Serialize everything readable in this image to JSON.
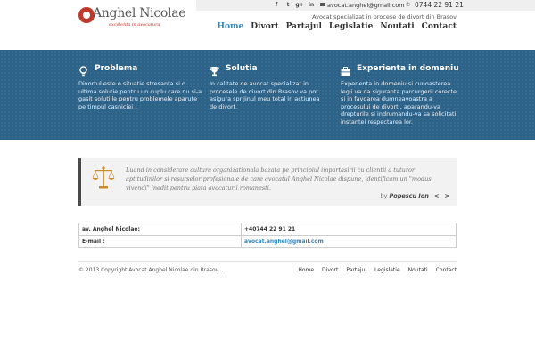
{
  "brand": {
    "name": "Anghel Nicolae",
    "tagline": "excelenta in avocatura"
  },
  "topbar": {
    "social": [
      {
        "icon": "facebook-icon",
        "glyph": "f"
      },
      {
        "icon": "twitter-icon",
        "glyph": "t"
      },
      {
        "icon": "google-plus-icon",
        "glyph": "g+"
      },
      {
        "icon": "linkedin-icon",
        "glyph": "in"
      }
    ],
    "email": "avocat.anghel@gmail.com",
    "phone": "0744 22 91 21"
  },
  "header": {
    "tagline": "Avocat specializat in procese de divort din Brasov"
  },
  "nav": {
    "items": [
      "Home",
      "Divort",
      "Partajul",
      "Legislatie",
      "Noutati",
      "Contact"
    ],
    "active": "Home"
  },
  "features": [
    {
      "icon": "lightbulb-icon",
      "title": "Problema",
      "text": "Divortul este o situatie stresanta si o ultima solutie pentru un cuplu care nu si-a gasit solutiile pentru problemele aparute pe timpul casniciei ."
    },
    {
      "icon": "trophy-icon",
      "title": "Solutia",
      "text": "In calitate de avocat specializat in procesele de divort din Brasov va pot asigura sprijinul meu total in actiunea de divort."
    },
    {
      "icon": "briefcase-icon",
      "title": "Experienta in domeniu",
      "text": "Experienta in domeniu si cunoasterea legii va da siguranta parcurgerii corecte si in favoarea dumneavoastra a procesului de divort , aparandu-va drepturile si indrumandu-va sa solicitati instantei respectarea lor."
    }
  ],
  "quote": {
    "text": "Luand in considerare cultura organizationala bazata pe principiul impartasirii cu clientii a tuturor aptitudinilor si resurselor profesionale de care avocatul Anghel Nicolae dispune, identificam un \"modus vivendi\" inedit pentru piata avocaturii romanesti.",
    "by": "by",
    "author": "Popescu Ion",
    "prev": "<",
    "next": ">"
  },
  "contact": [
    {
      "label": "av. Anghel Nicolae:",
      "value": "+40744 22 91 21",
      "link": false
    },
    {
      "label": "E-mail :",
      "value": "avocat.anghel@gmail.com",
      "link": true
    }
  ],
  "footer": {
    "copyright": "© 2013 Copyright Avocat Anghel Nicolae din Brasov. .",
    "links": [
      "Home",
      "Divort",
      "Partajul",
      "Legislatie",
      "Noutati",
      "Contact"
    ]
  },
  "colors": {
    "accent": "#2e87c2",
    "band": "#2d6389",
    "logo": "#c0392b"
  }
}
